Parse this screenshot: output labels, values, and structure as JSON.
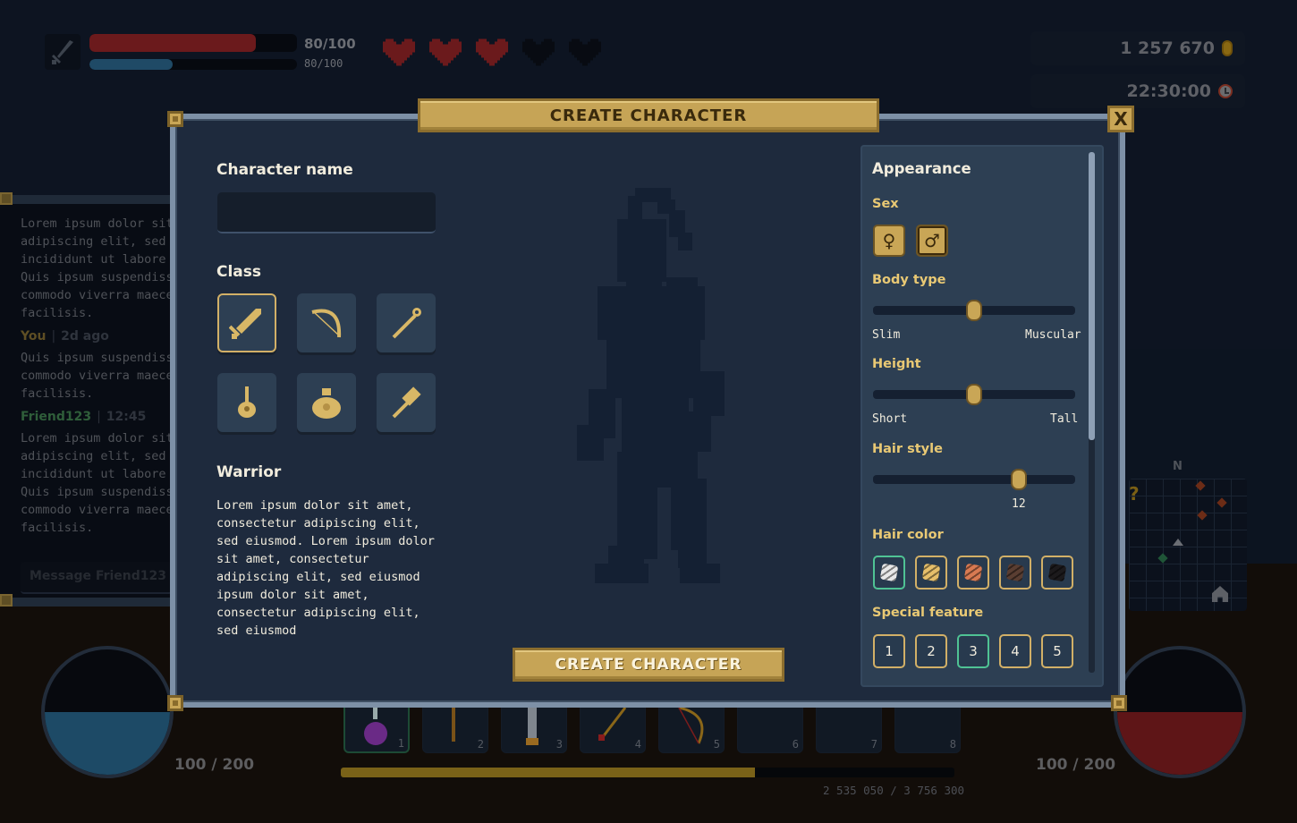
{
  "hud": {
    "health": {
      "current": 80,
      "max": 100,
      "label": "80/100",
      "fill": 0.8
    },
    "mana": {
      "current": 80,
      "max": 100,
      "label": "80/100",
      "fill": 0.4
    },
    "hearts": {
      "filled": 3,
      "total": 5
    },
    "gold": "1 257 670",
    "time": "22:30:00",
    "hp_orb": {
      "label": "100 / 200",
      "fill": 0.5
    },
    "mana_orb": {
      "label": "100 / 200",
      "fill": 0.5
    },
    "xp": {
      "label": "2 535 050 / 3 756 300",
      "fill": 0.675
    },
    "hotbar": [
      {
        "num": "1",
        "item": "potion",
        "active": true
      },
      {
        "num": "2",
        "item": "axe"
      },
      {
        "num": "3",
        "item": "saw"
      },
      {
        "num": "4",
        "item": "arrow"
      },
      {
        "num": "5",
        "item": "bow"
      },
      {
        "num": "6",
        "item": ""
      },
      {
        "num": "7",
        "item": ""
      },
      {
        "num": "8",
        "item": ""
      }
    ],
    "minimap": {
      "north_label": "N",
      "quest_marker": "?"
    }
  },
  "chat": {
    "messages": [
      {
        "author": "",
        "time": "",
        "text": "Lorem ipsum dolor sit\nadipiscing elit, sed\nincididunt ut labore\nQuis ipsum suspendiss\ncommodo viverra maece\nfacilisis."
      },
      {
        "author": "You",
        "time": "2d ago",
        "text": "Quis ipsum suspendiss\ncommodo viverra maece\nfacilisis."
      },
      {
        "author": "Friend123",
        "time": "12:45",
        "text": "Lorem ipsum dolor sit\nadipiscing elit, sed\nincididunt ut labore\nQuis ipsum suspendiss\ncommodo viverra maece\nfacilisis."
      }
    ],
    "separator": "|",
    "input_placeholder": "Message Friend123"
  },
  "modal": {
    "title": "CREATE CHARACTER",
    "close_label": "X",
    "name_label": "Character name",
    "name_value": "",
    "class_label": "Class",
    "classes": [
      {
        "name": "Warrior",
        "icon": "sword-icon",
        "selected": true
      },
      {
        "name": "Ranger",
        "icon": "bow-icon"
      },
      {
        "name": "Mage",
        "icon": "staff-icon"
      },
      {
        "name": "Bard",
        "icon": "lute-icon"
      },
      {
        "name": "Merchant",
        "icon": "money-bag-icon"
      },
      {
        "name": "Builder",
        "icon": "hammer-icon"
      }
    ],
    "selected_class_title": "Warrior",
    "selected_class_desc": "Lorem ipsum dolor sit amet,\nconsectetur adipiscing elit,\nsed eiusmod. Lorem ipsum dolor\nsit amet, consectetur\nadipiscing elit, sed eiusmod\nipsum dolor sit amet,\nconsectetur adipiscing elit,\nsed eiusmod",
    "create_button": "CREATE CHARACTER",
    "appearance": {
      "title": "Appearance",
      "sex_label": "Sex",
      "sex_options": [
        {
          "symbol": "♀",
          "name": "female"
        },
        {
          "symbol": "♂",
          "name": "male",
          "selected": true
        }
      ],
      "body_type": {
        "label": "Body type",
        "min_label": "Slim",
        "max_label": "Muscular",
        "value": 0.5
      },
      "height": {
        "label": "Height",
        "min_label": "Short",
        "max_label": "Tall",
        "value": 0.5
      },
      "hair_style": {
        "label": "Hair style",
        "value_label": "12",
        "value": 0.72
      },
      "hair_color": {
        "label": "Hair color",
        "options": [
          "#e8e8e8",
          "#e6bf6a",
          "#d97a52",
          "#5a3e32",
          "#1c1a1c"
        ],
        "selected_index": 0
      },
      "special_feature": {
        "label": "Special feature",
        "options": [
          "1",
          "2",
          "3",
          "4",
          "5"
        ],
        "selected_index": 2
      }
    }
  }
}
